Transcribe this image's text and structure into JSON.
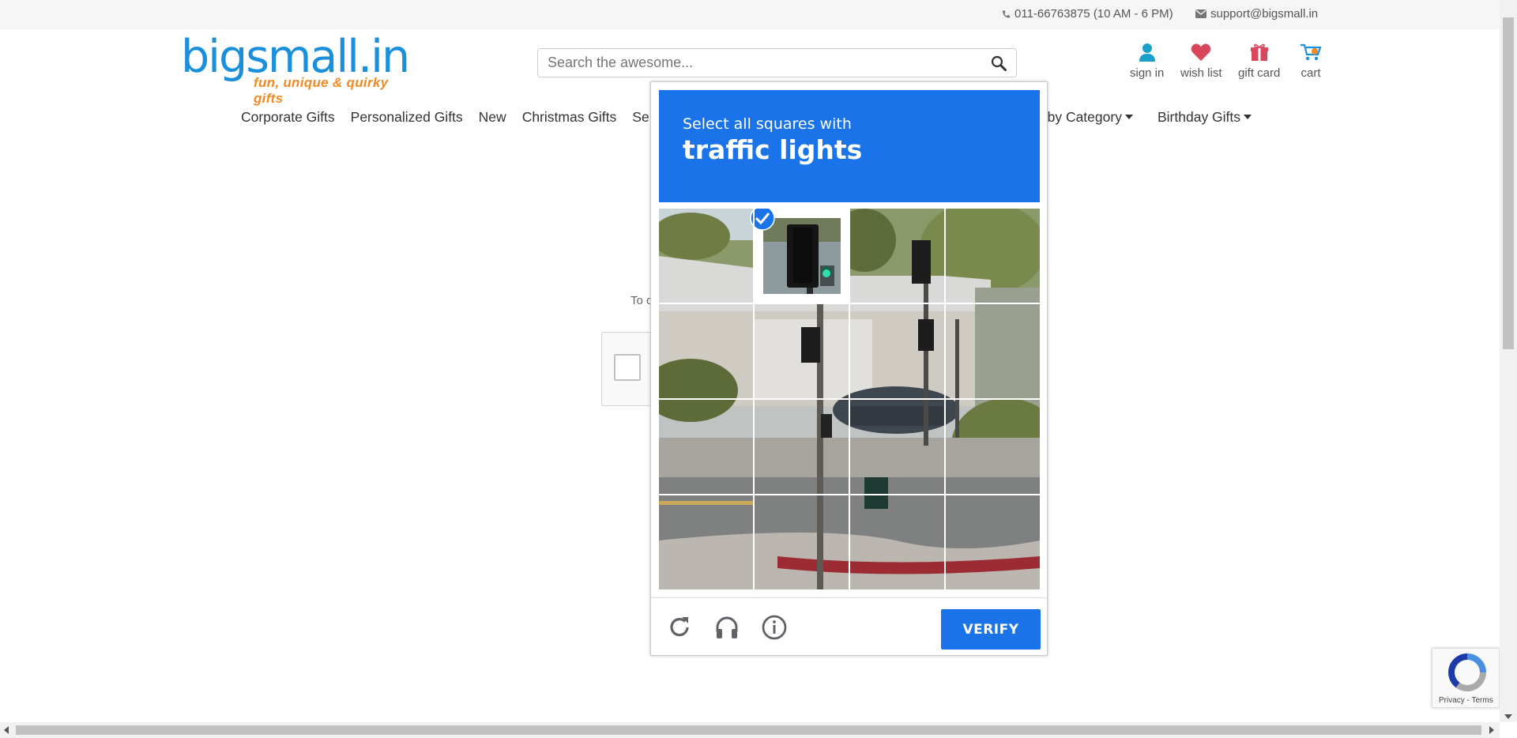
{
  "topbar": {
    "phone": "011-66763875 (10 AM - 6 PM)",
    "email": "support@bigsmall.in"
  },
  "logo": {
    "brand": "bigsmall.in",
    "tagline": "fun, unique & quirky gifts"
  },
  "search": {
    "placeholder": "Search the awesome..."
  },
  "header_icons": [
    {
      "label": "sign in",
      "icon": "user-icon"
    },
    {
      "label": "wish list",
      "icon": "heart-icon"
    },
    {
      "label": "gift card",
      "icon": "gift-icon"
    },
    {
      "label": "cart",
      "icon": "cart-icon"
    }
  ],
  "nav": {
    "items": [
      "Corporate Gifts",
      "Personalized Gifts",
      "New",
      "Christmas Gifts",
      "Se"
    ],
    "right_items": [
      "p by Category",
      "Birthday Gifts"
    ]
  },
  "page": {
    "partial_text": "To c"
  },
  "captcha": {
    "instruction_line1": "Select all squares with",
    "instruction_line2": "traffic lights",
    "selected_tiles": [
      1
    ],
    "verify_label": "VERIFY",
    "footer_icons": [
      "reload-icon",
      "audio-icon",
      "info-icon"
    ]
  },
  "recaptcha_badge": {
    "terms": "Privacy - Terms"
  },
  "colors": {
    "accent": "#1a73e8",
    "brand_blue": "#1a8fdc",
    "brand_orange": "#f08a24"
  }
}
